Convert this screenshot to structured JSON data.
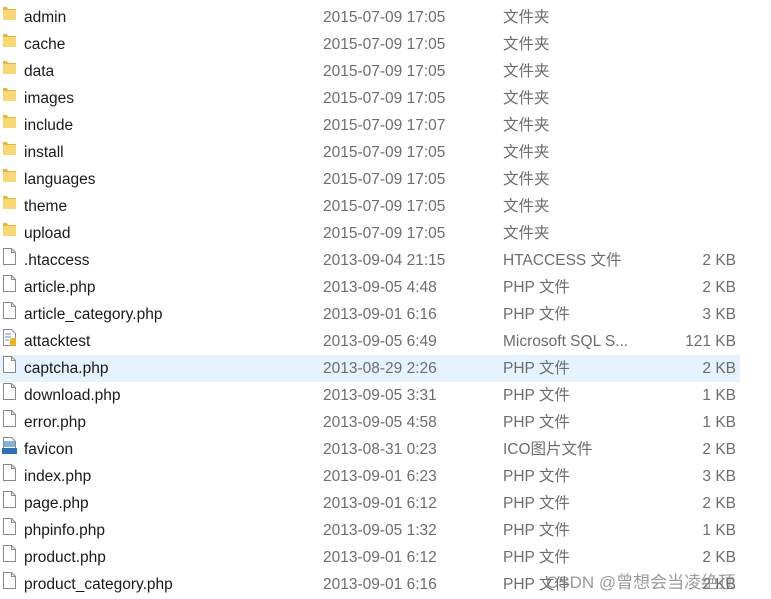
{
  "colors": {
    "folder": "#f4c64f",
    "selected_row": "#e5f3ff"
  },
  "selected_index": 13,
  "files": [
    {
      "name": "admin",
      "date": "2015-07-09 17:05",
      "type": "文件夹",
      "size": "",
      "icon": "folder-icon"
    },
    {
      "name": "cache",
      "date": "2015-07-09 17:05",
      "type": "文件夹",
      "size": "",
      "icon": "folder-icon"
    },
    {
      "name": "data",
      "date": "2015-07-09 17:05",
      "type": "文件夹",
      "size": "",
      "icon": "folder-icon"
    },
    {
      "name": "images",
      "date": "2015-07-09 17:05",
      "type": "文件夹",
      "size": "",
      "icon": "folder-icon"
    },
    {
      "name": "include",
      "date": "2015-07-09 17:07",
      "type": "文件夹",
      "size": "",
      "icon": "folder-icon"
    },
    {
      "name": "install",
      "date": "2015-07-09 17:05",
      "type": "文件夹",
      "size": "",
      "icon": "folder-icon"
    },
    {
      "name": "languages",
      "date": "2015-07-09 17:05",
      "type": "文件夹",
      "size": "",
      "icon": "folder-icon"
    },
    {
      "name": "theme",
      "date": "2015-07-09 17:05",
      "type": "文件夹",
      "size": "",
      "icon": "folder-icon"
    },
    {
      "name": "upload",
      "date": "2015-07-09 17:05",
      "type": "文件夹",
      "size": "",
      "icon": "folder-icon"
    },
    {
      "name": ".htaccess",
      "date": "2013-09-04 21:15",
      "type": "HTACCESS 文件",
      "size": "2 KB",
      "icon": "file-icon"
    },
    {
      "name": "article.php",
      "date": "2013-09-05 4:48",
      "type": "PHP 文件",
      "size": "2 KB",
      "icon": "file-icon"
    },
    {
      "name": "article_category.php",
      "date": "2013-09-01 6:16",
      "type": "PHP 文件",
      "size": "3 KB",
      "icon": "file-icon"
    },
    {
      "name": "attacktest",
      "date": "2013-09-05 6:49",
      "type": "Microsoft SQL S...",
      "size": "121 KB",
      "icon": "database-file-icon"
    },
    {
      "name": "captcha.php",
      "date": "2013-08-29 2:26",
      "type": "PHP 文件",
      "size": "2 KB",
      "icon": "file-icon"
    },
    {
      "name": "download.php",
      "date": "2013-09-05 3:31",
      "type": "PHP 文件",
      "size": "1 KB",
      "icon": "file-icon"
    },
    {
      "name": "error.php",
      "date": "2013-09-05 4:58",
      "type": "PHP 文件",
      "size": "1 KB",
      "icon": "file-icon"
    },
    {
      "name": "favicon",
      "date": "2013-08-31 0:23",
      "type": "ICO图片文件",
      "size": "2 KB",
      "icon": "ico-file-icon"
    },
    {
      "name": "index.php",
      "date": "2013-09-01 6:23",
      "type": "PHP 文件",
      "size": "3 KB",
      "icon": "file-icon"
    },
    {
      "name": "page.php",
      "date": "2013-09-01 6:12",
      "type": "PHP 文件",
      "size": "2 KB",
      "icon": "file-icon"
    },
    {
      "name": "phpinfo.php",
      "date": "2013-09-05 1:32",
      "type": "PHP 文件",
      "size": "1 KB",
      "icon": "file-icon"
    },
    {
      "name": "product.php",
      "date": "2013-09-01 6:12",
      "type": "PHP 文件",
      "size": "2 KB",
      "icon": "file-icon"
    },
    {
      "name": "product_category.php",
      "date": "2013-09-01 6:16",
      "type": "PHP 文件",
      "size": "2 KB",
      "icon": "file-icon"
    }
  ],
  "watermark": "CSDN @曾想会当凌绝顶"
}
